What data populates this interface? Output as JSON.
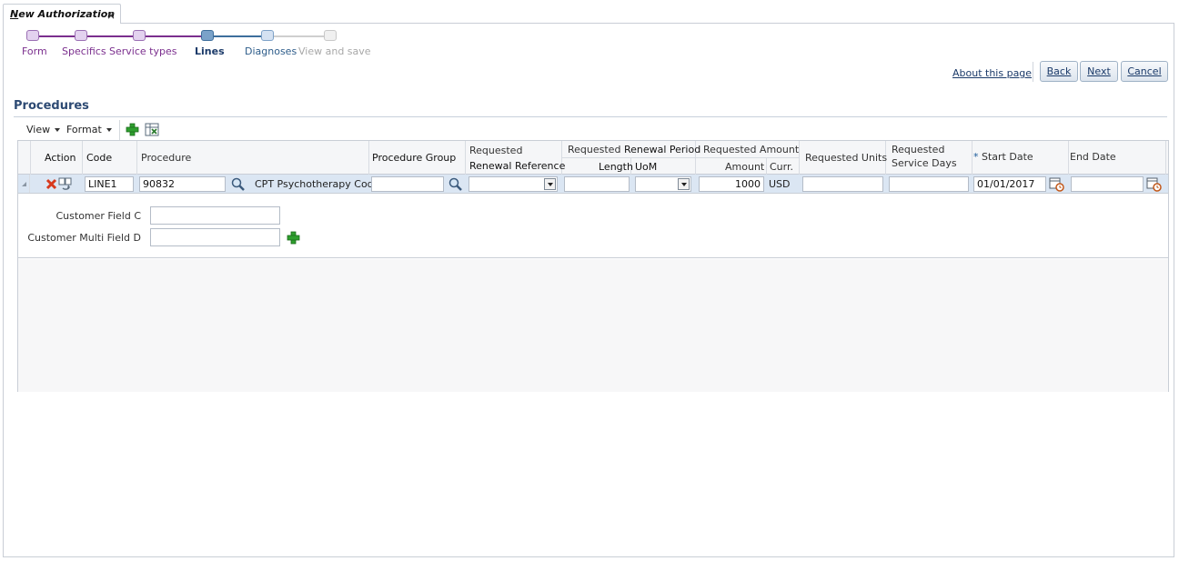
{
  "tab": {
    "title_first": "N",
    "title_rest": "ew Authorization",
    "close": "×"
  },
  "train": {
    "stops": [
      {
        "label": "Form",
        "state": "visited"
      },
      {
        "label": "Specifics",
        "state": "visited"
      },
      {
        "label": "Service types",
        "state": "visited"
      },
      {
        "label": "Lines",
        "state": "current"
      },
      {
        "label": "Diagnoses",
        "state": "next"
      },
      {
        "label": "View and save",
        "state": "disabled"
      }
    ]
  },
  "header": {
    "about": "About this page",
    "back": "Back",
    "next": "Next",
    "cancel": "Cancel"
  },
  "section": {
    "title": "Procedures"
  },
  "toolbar": {
    "view": "View",
    "format": "Format"
  },
  "table": {
    "columns": {
      "action": "Action",
      "code": "Code",
      "procedure": "Procedure",
      "procedure_group": "Procedure Group",
      "requested": "Requested",
      "renewal_reference": "Renewal Reference",
      "requested_prefix": "Requested",
      "renewal_period": "Renewal Period",
      "length": "Length",
      "uom": "UoM",
      "requested_amount": "Requested Amount",
      "amount": "Amount",
      "curr": "Curr.",
      "requested_units": "Requested Units",
      "requested_service_days_1": "Requested",
      "requested_service_days_2": "Service Days",
      "required_star": "*",
      "start_date": "Start Date",
      "end_date": "End Date"
    },
    "row": {
      "code": "LINE1",
      "procedure_code": "90832",
      "procedure_desc": "CPT Psychotherapy Code",
      "procedure_group": "",
      "renewal_reference": "",
      "length": "",
      "uom": "",
      "amount": "1000",
      "currency": "USD",
      "requested_units": "",
      "requested_service_days": "",
      "start_date": "01/01/2017",
      "end_date": ""
    },
    "detail": {
      "customer_field_c": "Customer Field C",
      "customer_multi_field_d": "Customer Multi Field D"
    }
  },
  "colors": {
    "visited": "#7b2f8e",
    "current": "#1b3a69",
    "accent": "#2d4a73",
    "row_selected": "#dbe6f3"
  }
}
